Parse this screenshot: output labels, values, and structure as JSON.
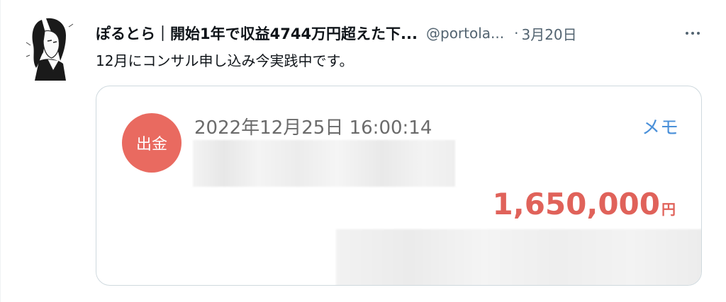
{
  "tweet": {
    "display_name": "ぽるとら｜開始1年で収益4744万円超えた下...",
    "handle": "@portola...",
    "separator": "·",
    "timestamp": "3月20日",
    "text": "12月にコンサル申し込み今実践中です。",
    "more_icon": "more-horizontal-icon"
  },
  "transaction": {
    "badge": "出金",
    "date": "2022年12月25日 16:00:14",
    "memo_label": "メモ",
    "amount": "1,650,000",
    "currency": "円"
  },
  "colors": {
    "badge_bg": "#e96a60",
    "amount": "#e0625a",
    "memo_link": "#4a90d9",
    "text_primary": "#0f1419",
    "text_secondary": "#536471"
  }
}
